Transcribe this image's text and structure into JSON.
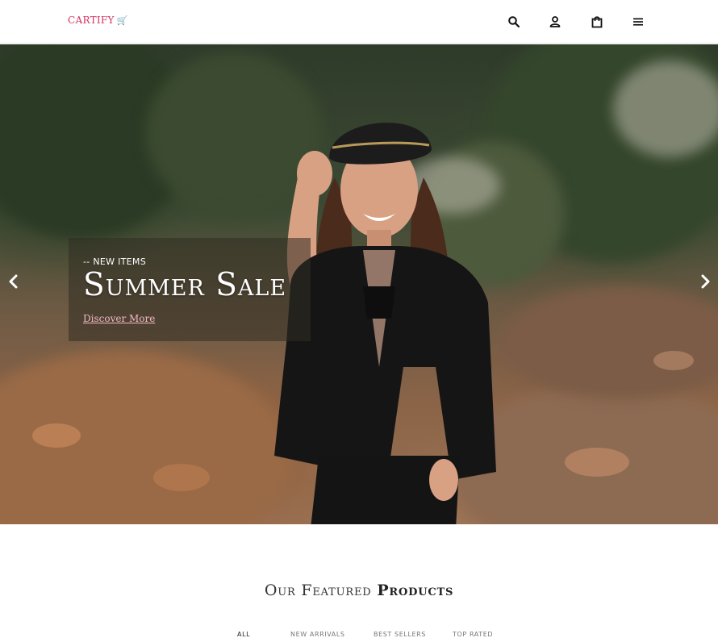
{
  "header": {
    "logo_text": "CARTIFY",
    "logo_icon": "cart-icon",
    "icons": [
      "search-icon",
      "user-icon",
      "bag-icon",
      "menu-icon"
    ]
  },
  "hero": {
    "tag": "-- NEW ITEMS",
    "title": "Summer Sale",
    "link": "Discover More",
    "prev_icon": "chevron-left-icon",
    "next_icon": "chevron-right-icon"
  },
  "featured": {
    "title_light": "Our Featured",
    "title_bold": "Products",
    "tabs": [
      "ALL",
      "NEW ARRIVALS",
      "BEST SELLERS",
      "TOP RATED"
    ]
  },
  "colors": {
    "brand": "#d6335e",
    "link": "#f2b8c6"
  }
}
